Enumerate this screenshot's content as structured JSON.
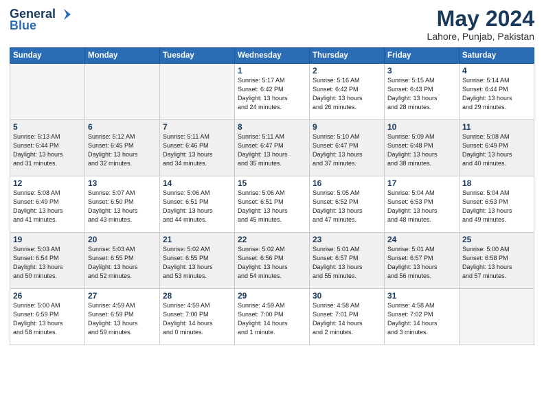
{
  "header": {
    "logo_line1": "General",
    "logo_line2": "Blue",
    "title": "May 2024",
    "subtitle": "Lahore, Punjab, Pakistan"
  },
  "calendar": {
    "days_of_week": [
      "Sunday",
      "Monday",
      "Tuesday",
      "Wednesday",
      "Thursday",
      "Friday",
      "Saturday"
    ],
    "weeks": [
      {
        "shaded": false,
        "days": [
          {
            "num": "",
            "detail": ""
          },
          {
            "num": "",
            "detail": ""
          },
          {
            "num": "",
            "detail": ""
          },
          {
            "num": "1",
            "detail": "Sunrise: 5:17 AM\nSunset: 6:42 PM\nDaylight: 13 hours\nand 24 minutes."
          },
          {
            "num": "2",
            "detail": "Sunrise: 5:16 AM\nSunset: 6:42 PM\nDaylight: 13 hours\nand 26 minutes."
          },
          {
            "num": "3",
            "detail": "Sunrise: 5:15 AM\nSunset: 6:43 PM\nDaylight: 13 hours\nand 28 minutes."
          },
          {
            "num": "4",
            "detail": "Sunrise: 5:14 AM\nSunset: 6:44 PM\nDaylight: 13 hours\nand 29 minutes."
          }
        ]
      },
      {
        "shaded": true,
        "days": [
          {
            "num": "5",
            "detail": "Sunrise: 5:13 AM\nSunset: 6:44 PM\nDaylight: 13 hours\nand 31 minutes."
          },
          {
            "num": "6",
            "detail": "Sunrise: 5:12 AM\nSunset: 6:45 PM\nDaylight: 13 hours\nand 32 minutes."
          },
          {
            "num": "7",
            "detail": "Sunrise: 5:11 AM\nSunset: 6:46 PM\nDaylight: 13 hours\nand 34 minutes."
          },
          {
            "num": "8",
            "detail": "Sunrise: 5:11 AM\nSunset: 6:47 PM\nDaylight: 13 hours\nand 35 minutes."
          },
          {
            "num": "9",
            "detail": "Sunrise: 5:10 AM\nSunset: 6:47 PM\nDaylight: 13 hours\nand 37 minutes."
          },
          {
            "num": "10",
            "detail": "Sunrise: 5:09 AM\nSunset: 6:48 PM\nDaylight: 13 hours\nand 38 minutes."
          },
          {
            "num": "11",
            "detail": "Sunrise: 5:08 AM\nSunset: 6:49 PM\nDaylight: 13 hours\nand 40 minutes."
          }
        ]
      },
      {
        "shaded": false,
        "days": [
          {
            "num": "12",
            "detail": "Sunrise: 5:08 AM\nSunset: 6:49 PM\nDaylight: 13 hours\nand 41 minutes."
          },
          {
            "num": "13",
            "detail": "Sunrise: 5:07 AM\nSunset: 6:50 PM\nDaylight: 13 hours\nand 43 minutes."
          },
          {
            "num": "14",
            "detail": "Sunrise: 5:06 AM\nSunset: 6:51 PM\nDaylight: 13 hours\nand 44 minutes."
          },
          {
            "num": "15",
            "detail": "Sunrise: 5:06 AM\nSunset: 6:51 PM\nDaylight: 13 hours\nand 45 minutes."
          },
          {
            "num": "16",
            "detail": "Sunrise: 5:05 AM\nSunset: 6:52 PM\nDaylight: 13 hours\nand 47 minutes."
          },
          {
            "num": "17",
            "detail": "Sunrise: 5:04 AM\nSunset: 6:53 PM\nDaylight: 13 hours\nand 48 minutes."
          },
          {
            "num": "18",
            "detail": "Sunrise: 5:04 AM\nSunset: 6:53 PM\nDaylight: 13 hours\nand 49 minutes."
          }
        ]
      },
      {
        "shaded": true,
        "days": [
          {
            "num": "19",
            "detail": "Sunrise: 5:03 AM\nSunset: 6:54 PM\nDaylight: 13 hours\nand 50 minutes."
          },
          {
            "num": "20",
            "detail": "Sunrise: 5:03 AM\nSunset: 6:55 PM\nDaylight: 13 hours\nand 52 minutes."
          },
          {
            "num": "21",
            "detail": "Sunrise: 5:02 AM\nSunset: 6:55 PM\nDaylight: 13 hours\nand 53 minutes."
          },
          {
            "num": "22",
            "detail": "Sunrise: 5:02 AM\nSunset: 6:56 PM\nDaylight: 13 hours\nand 54 minutes."
          },
          {
            "num": "23",
            "detail": "Sunrise: 5:01 AM\nSunset: 6:57 PM\nDaylight: 13 hours\nand 55 minutes."
          },
          {
            "num": "24",
            "detail": "Sunrise: 5:01 AM\nSunset: 6:57 PM\nDaylight: 13 hours\nand 56 minutes."
          },
          {
            "num": "25",
            "detail": "Sunrise: 5:00 AM\nSunset: 6:58 PM\nDaylight: 13 hours\nand 57 minutes."
          }
        ]
      },
      {
        "shaded": false,
        "days": [
          {
            "num": "26",
            "detail": "Sunrise: 5:00 AM\nSunset: 6:59 PM\nDaylight: 13 hours\nand 58 minutes."
          },
          {
            "num": "27",
            "detail": "Sunrise: 4:59 AM\nSunset: 6:59 PM\nDaylight: 13 hours\nand 59 minutes."
          },
          {
            "num": "28",
            "detail": "Sunrise: 4:59 AM\nSunset: 7:00 PM\nDaylight: 14 hours\nand 0 minutes."
          },
          {
            "num": "29",
            "detail": "Sunrise: 4:59 AM\nSunset: 7:00 PM\nDaylight: 14 hours\nand 1 minute."
          },
          {
            "num": "30",
            "detail": "Sunrise: 4:58 AM\nSunset: 7:01 PM\nDaylight: 14 hours\nand 2 minutes."
          },
          {
            "num": "31",
            "detail": "Sunrise: 4:58 AM\nSunset: 7:02 PM\nDaylight: 14 hours\nand 3 minutes."
          },
          {
            "num": "",
            "detail": ""
          }
        ]
      }
    ]
  }
}
